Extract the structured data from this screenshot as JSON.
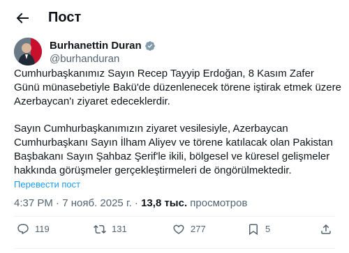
{
  "header": {
    "title": "Пост"
  },
  "author": {
    "name": "Burhanettin Duran",
    "handle": "@burhanduran"
  },
  "post": {
    "paragraph1": "Cumhurbaşkanımız Sayın Recep Tayyip Erdoğan, 8 Kasım Zafer Günü münasebetiyle Bakü'de düzenlenecek törene iştirak etmek üzere Azerbaycan'ı ziyaret edeceklerdir.",
    "paragraph2": "Sayın Cumhurbaşkanımızın ziyaret vesilesiyle, Azerbaycan Cumhurbaşkanı Sayın İlham Aliyev ve törene katılacak olan Pakistan Başbakanı Sayın Şahbaz Şerif'le ikili, bölgesel ve küresel gelişmeler hakkında görüşmeler gerçekleştirmeleri de öngörülmektedir.",
    "translate_label": "Перевести пост"
  },
  "meta": {
    "time": "4:37 PM",
    "date": "7 нояб. 2025 г.",
    "views_count": "13,8 тыс.",
    "views_label": "просмотров"
  },
  "actions": {
    "replies": "119",
    "reposts": "131",
    "likes": "277",
    "bookmarks": "5"
  },
  "icons": {
    "back": "arrow-left-icon",
    "verified": "verified-badge-icon",
    "reply": "reply-icon",
    "repost": "repost-icon",
    "like": "heart-icon",
    "bookmark": "bookmark-icon",
    "share": "share-icon"
  },
  "colors": {
    "text": "#0f1419",
    "secondary": "#536471",
    "link": "#1d9bf0",
    "divider": "#eff3f4"
  }
}
